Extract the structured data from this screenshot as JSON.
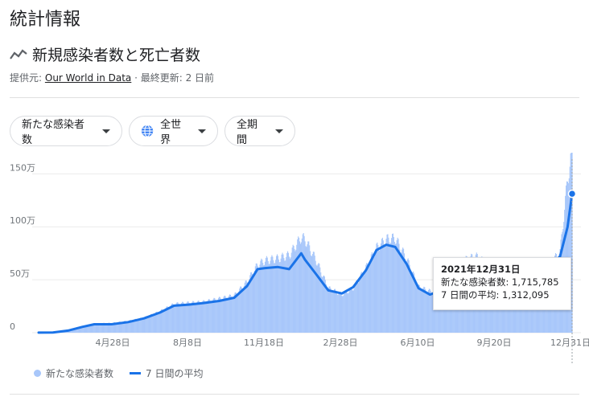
{
  "header": {
    "title": "統計情報",
    "subtitle": "新規感染者数と死亡者数",
    "source_prefix": "提供元:",
    "source_link": "Our World in Data",
    "updated": "· 最終更新: 2 日前"
  },
  "filters": [
    {
      "label": "新たな感染者数"
    },
    {
      "label": "全世界"
    },
    {
      "label": "全期間"
    }
  ],
  "tooltip": {
    "date": "2021年12月31日",
    "cases_label": "新たな感染者数:",
    "cases_value": "1,715,785",
    "avg_label": "7 日間の平均:",
    "avg_value": "1,312,095"
  },
  "legend": {
    "bars": "新たな感染者数",
    "line": "7 日間の平均"
  },
  "colors": {
    "bar": "#a8c7fa",
    "line": "#1a73e8"
  },
  "chart_data": {
    "type": "bar",
    "x_ticks": [
      "4月28日",
      "8月8日",
      "11月18日",
      "2月28日",
      "6月10日",
      "9月20日",
      "12月31日"
    ],
    "y_ticks": [
      "0",
      "50万",
      "100万",
      "150万"
    ],
    "y_tick_values": [
      0,
      500000,
      1000000,
      1500000
    ],
    "ylim": [
      0,
      1700000
    ],
    "series": [
      {
        "name": "新たな感染者数",
        "type": "bar",
        "x": [
          "2020-01-22",
          "2020-02-10",
          "2020-03-01",
          "2020-03-20",
          "2020-04-05",
          "2020-04-28",
          "2020-05-20",
          "2020-06-10",
          "2020-07-01",
          "2020-07-20",
          "2020-08-08",
          "2020-08-28",
          "2020-09-18",
          "2020-10-08",
          "2020-10-25",
          "2020-11-08",
          "2020-11-18",
          "2020-12-05",
          "2020-12-20",
          "2021-01-05",
          "2021-01-10",
          "2021-01-25",
          "2021-02-10",
          "2021-02-28",
          "2021-03-15",
          "2021-04-01",
          "2021-04-15",
          "2021-04-28",
          "2021-05-10",
          "2021-05-25",
          "2021-06-10",
          "2021-06-25",
          "2021-07-10",
          "2021-07-28",
          "2021-08-10",
          "2021-08-25",
          "2021-09-10",
          "2021-09-20",
          "2021-10-10",
          "2021-10-28",
          "2021-11-15",
          "2021-12-01",
          "2021-12-15",
          "2021-12-25",
          "2021-12-31"
        ],
        "values": [
          1000,
          2000,
          30000,
          60000,
          85000,
          90000,
          110000,
          140000,
          200000,
          270000,
          280000,
          290000,
          320000,
          350000,
          480000,
          640000,
          680000,
          700000,
          730000,
          900000,
          880000,
          680000,
          420000,
          360000,
          420000,
          610000,
          800000,
          880000,
          890000,
          700000,
          430000,
          390000,
          420000,
          560000,
          680000,
          720000,
          640000,
          510000,
          430000,
          440000,
          520000,
          640000,
          760000,
          1450000,
          1715785
        ]
      },
      {
        "name": "7 日間の平均",
        "type": "line",
        "x": [
          "2020-01-22",
          "2020-02-10",
          "2020-03-01",
          "2020-03-20",
          "2020-04-05",
          "2020-04-28",
          "2020-05-20",
          "2020-06-10",
          "2020-07-01",
          "2020-07-20",
          "2020-08-08",
          "2020-08-28",
          "2020-09-18",
          "2020-10-08",
          "2020-10-25",
          "2020-11-08",
          "2020-11-18",
          "2020-12-05",
          "2020-12-20",
          "2021-01-05",
          "2021-01-10",
          "2021-01-25",
          "2021-02-10",
          "2021-02-28",
          "2021-03-15",
          "2021-04-01",
          "2021-04-15",
          "2021-04-28",
          "2021-05-10",
          "2021-05-25",
          "2021-06-10",
          "2021-06-25",
          "2021-07-10",
          "2021-07-28",
          "2021-08-10",
          "2021-08-25",
          "2021-09-10",
          "2021-09-20",
          "2021-10-10",
          "2021-10-28",
          "2021-11-15",
          "2021-12-01",
          "2021-12-15",
          "2021-12-25",
          "2021-12-31"
        ],
        "values": [
          1000,
          2000,
          20000,
          55000,
          80000,
          80000,
          100000,
          135000,
          190000,
          255000,
          265000,
          280000,
          300000,
          330000,
          440000,
          600000,
          610000,
          620000,
          600000,
          750000,
          690000,
          550000,
          400000,
          370000,
          430000,
          590000,
          780000,
          830000,
          810000,
          650000,
          420000,
          360000,
          400000,
          520000,
          650000,
          680000,
          590000,
          490000,
          430000,
          430000,
          500000,
          620000,
          720000,
          1000000,
          1312095
        ]
      }
    ]
  }
}
